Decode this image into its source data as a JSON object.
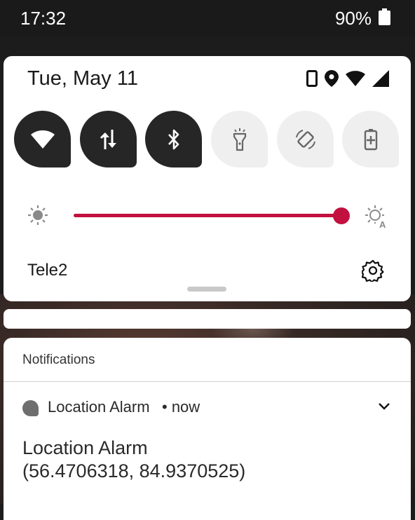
{
  "status_bar": {
    "time": "17:32",
    "battery_percent": "90%",
    "battery_icon": "battery-icon"
  },
  "quick_settings": {
    "date": "Tue, May 11",
    "status_icons": [
      "phone-icon",
      "location-icon",
      "wifi-icon",
      "cell-signal-icon"
    ],
    "tiles": [
      {
        "name": "wifi",
        "icon": "wifi-icon",
        "active": true
      },
      {
        "name": "mobile-data",
        "icon": "data-arrows-icon",
        "active": true
      },
      {
        "name": "bluetooth",
        "icon": "bluetooth-icon",
        "active": true
      },
      {
        "name": "flashlight",
        "icon": "flashlight-icon",
        "active": false
      },
      {
        "name": "auto-rotate",
        "icon": "rotate-icon",
        "active": false
      },
      {
        "name": "battery-saver",
        "icon": "battery-saver-icon",
        "active": false
      }
    ],
    "brightness": {
      "level": 1.0,
      "low_icon": "brightness-low-icon",
      "auto_icon": "brightness-auto-icon"
    },
    "carrier": "Tele2",
    "settings_icon": "gear-icon"
  },
  "colors": {
    "accent": "#c2103f",
    "tile_on": "#262626",
    "tile_off": "#efefef"
  },
  "notifications": {
    "header": "Notifications",
    "items": [
      {
        "app_name": "Location Alarm",
        "time": "• now",
        "title": "Location Alarm",
        "text": "(56.4706318, 84.9370525)"
      }
    ]
  }
}
